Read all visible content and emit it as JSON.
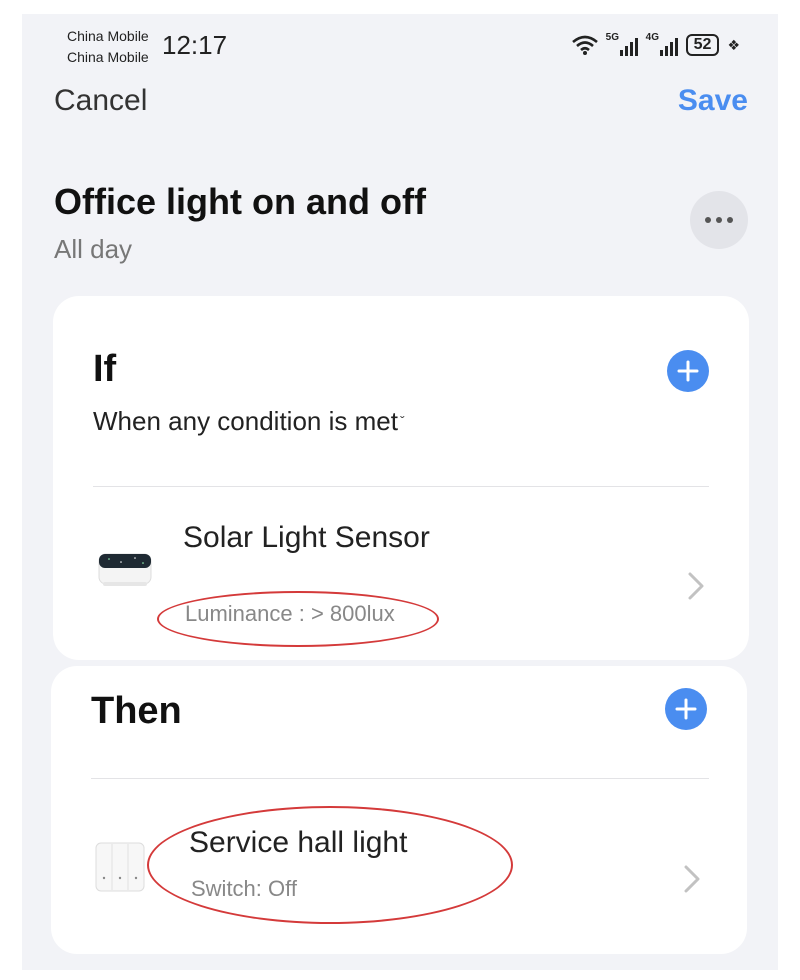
{
  "status_bar": {
    "carrier_1": "China Mobile",
    "carrier_2": "China Mobile",
    "time": "12:17",
    "network_1": "5G",
    "network_2": "4G",
    "battery": "52"
  },
  "header": {
    "cancel_label": "Cancel",
    "save_label": "Save",
    "title": "Office light on and off",
    "subtitle": "All day",
    "more_icon": "more-horizontal-icon"
  },
  "if_section": {
    "title": "If",
    "condition_mode": "When any condition is met",
    "add_icon": "plus-icon",
    "item": {
      "name": "Solar Light Sensor",
      "detail": "Luminance : > 800lux",
      "icon": "sensor-device-icon"
    }
  },
  "then_section": {
    "title": "Then",
    "add_icon": "plus-icon",
    "item": {
      "name": "Service hall light",
      "detail": "Switch: Off",
      "icon": "wall-switch-icon"
    }
  },
  "colors": {
    "accent": "#4a8df0",
    "background": "#f2f3f7",
    "annotation": "#d43a3a"
  }
}
